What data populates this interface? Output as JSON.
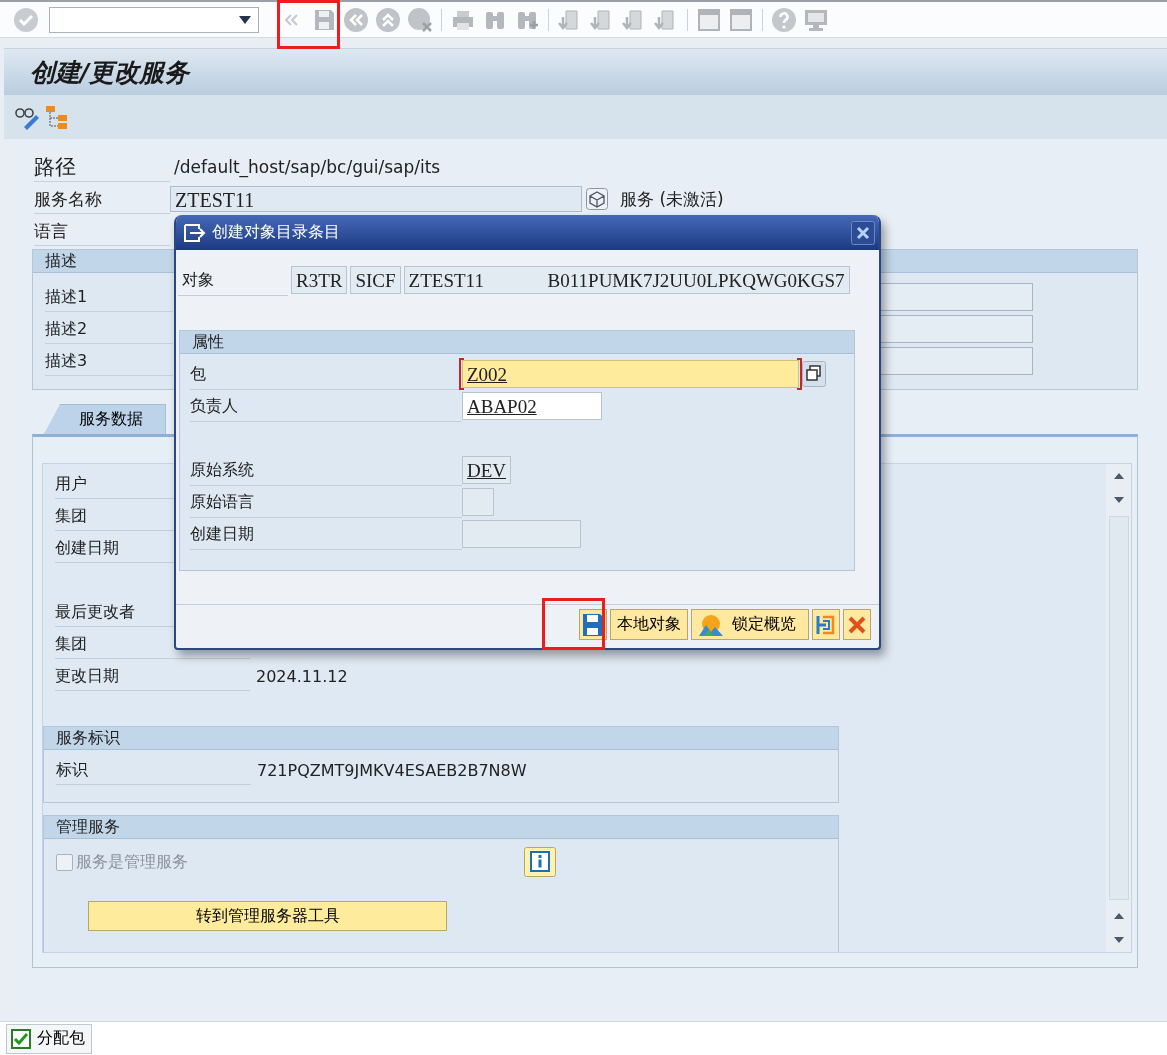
{
  "title": "创建/更改服务",
  "header_fields": [
    {
      "label": "路径",
      "kind": "text",
      "value": "/default_host/sap/bc/gui/sap/its"
    },
    {
      "label": "服务名称",
      "kind": "field",
      "value": "ZTEST11",
      "status": "服务 (未激活)"
    },
    {
      "label": "语言",
      "kind": "field"
    }
  ],
  "description_group": {
    "title": "描述",
    "rows": [
      "描述1",
      "描述2",
      "描述3"
    ]
  },
  "tabs": [
    {
      "label": "服务数据",
      "selected": true
    }
  ],
  "created_rows": [
    {
      "label": "用户"
    },
    {
      "label": "集团"
    },
    {
      "label": "创建日期"
    }
  ],
  "changed_rows": [
    {
      "label": "最后更改者"
    },
    {
      "label": "集团"
    },
    {
      "label": "更改日期",
      "value": "2024.11.12"
    }
  ],
  "service_id_group": {
    "title": "服务标识",
    "label": "标识",
    "value": "721PQZMT9JMKV4ESAEB2B7N8W"
  },
  "admin_group": {
    "title": "管理服务",
    "checkbox": {
      "label": "服务是管理服务",
      "checked": false,
      "disabled": true
    },
    "button": "转到管理服务器工具"
  },
  "status_bar": {
    "button": "分配包"
  },
  "dialog": {
    "title": "创建对象目录条目",
    "object": {
      "label": "对象",
      "parts": [
        "R3TR",
        "SICF"
      ],
      "name": "ZTEST11",
      "key": "B011PUMK7J2UU0LPKQWG0KGS7"
    },
    "group_title": "属性",
    "fields": [
      {
        "label": "包",
        "value": "Z002",
        "focused": true,
        "editable": true
      },
      {
        "label": "负责人",
        "value": "ABAP02",
        "focused": false,
        "editable": true
      }
    ],
    "origin_fields": [
      {
        "label": "原始系统",
        "value": "DEV"
      },
      {
        "label": "原始语言"
      },
      {
        "label": "创建日期"
      }
    ],
    "buttons": [
      {
        "kind": "save"
      },
      {
        "kind": "text",
        "label": "本地对象"
      },
      {
        "kind": "lock",
        "label": "锁定概览"
      },
      {
        "kind": "transport"
      },
      {
        "kind": "cancel"
      }
    ]
  }
}
